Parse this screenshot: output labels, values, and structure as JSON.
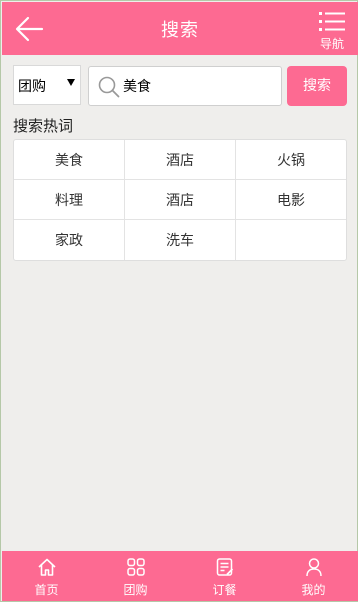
{
  "header": {
    "title": "搜索",
    "back_icon": "arrow-left-icon",
    "nav_label": "导航",
    "nav_icon": "list-menu-icon",
    "bg": "#fd6a92"
  },
  "search": {
    "category": "团购",
    "value": "美食",
    "button_label": "搜索"
  },
  "hot": {
    "title": "搜索热词",
    "words": [
      [
        "美食",
        "酒店",
        "火锅"
      ],
      [
        "料理",
        "酒店",
        "电影"
      ],
      [
        "家政",
        "洗车",
        ""
      ]
    ]
  },
  "tabbar": {
    "items": [
      {
        "label": "首页",
        "icon": "home-icon"
      },
      {
        "label": "团购",
        "icon": "grid-icon"
      },
      {
        "label": "订餐",
        "icon": "order-icon"
      },
      {
        "label": "我的",
        "icon": "user-icon"
      }
    ]
  }
}
